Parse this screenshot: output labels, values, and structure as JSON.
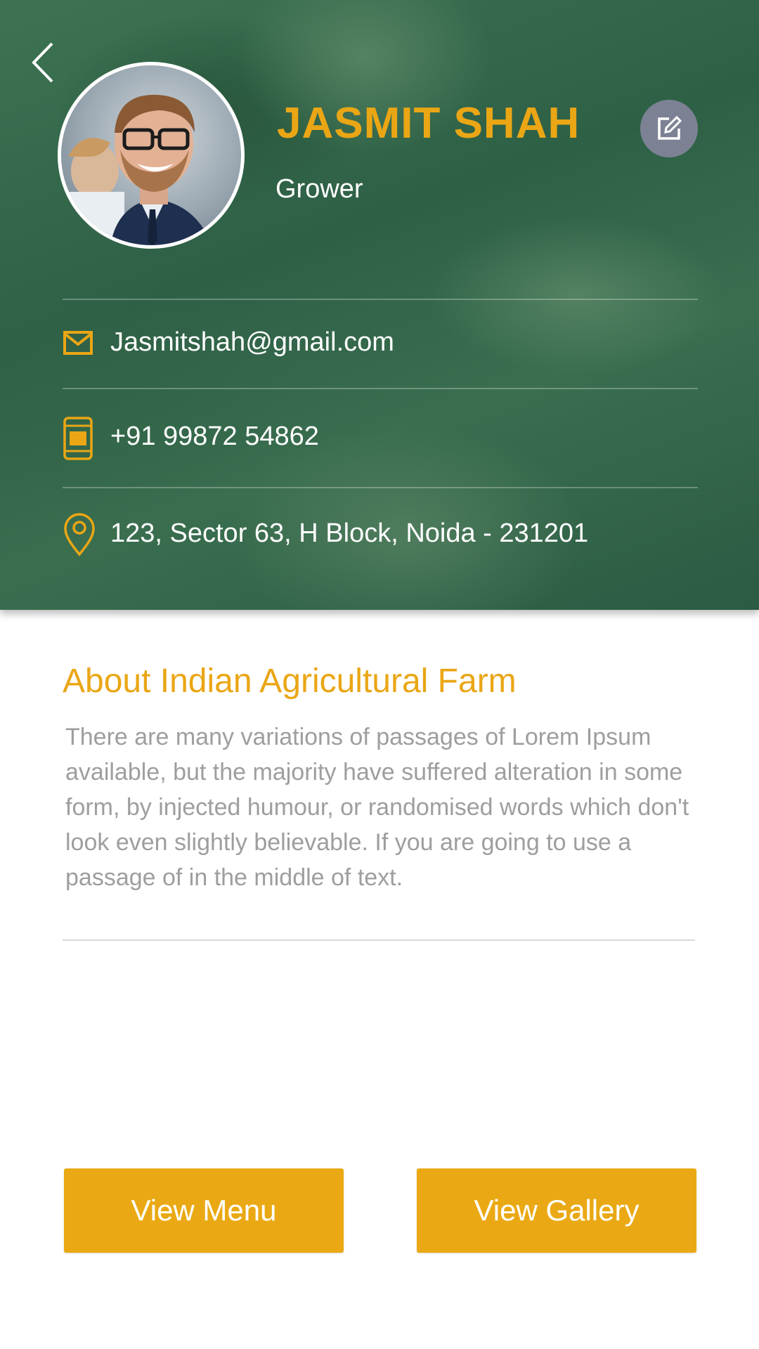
{
  "profile": {
    "name": "JASMIT SHAH",
    "role": "Grower",
    "email": "Jasmitshah@gmail.com",
    "phone": "+91 99872 54862",
    "address": "123, Sector 63, H Block, Noida - 231201"
  },
  "about": {
    "title": "About Indian Agricultural Farm",
    "text": "There are many variations of passages of Lorem Ipsum available, but the majority have suffered alteration in some form, by injected humour, or randomised words which don't look even slightly believable. If you are going to use a passage of in the middle of text."
  },
  "actions": {
    "view_menu": "View Menu",
    "view_gallery": "View Gallery"
  },
  "icons": {
    "back": "chevron-left-icon",
    "edit": "edit-icon",
    "email": "mail-icon",
    "phone": "mobile-phone-icon",
    "address": "location-pin-icon"
  },
  "colors": {
    "accent": "#eaa615",
    "header_green": "#2e6046",
    "edit_button": "#7c8294",
    "body_text": "#9e9e9e"
  }
}
